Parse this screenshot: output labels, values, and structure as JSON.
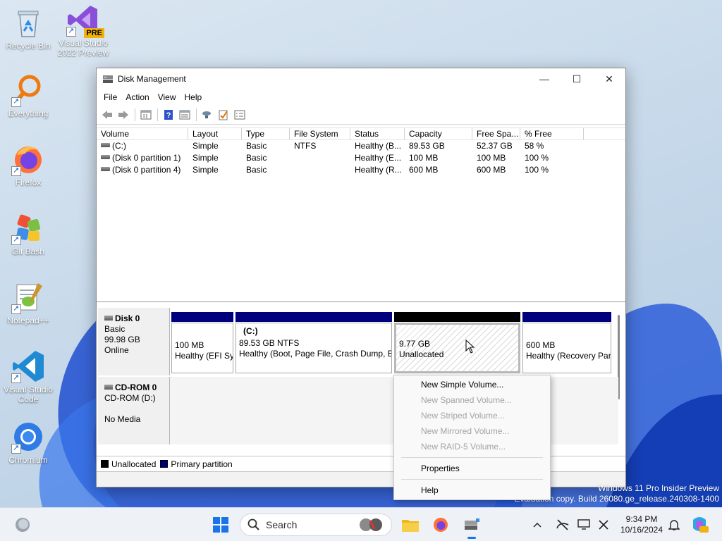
{
  "desktop": {
    "icons": [
      {
        "label": "Recycle Bin"
      },
      {
        "label": "Visual Studio\n2022 Preview",
        "badge": "PRE"
      },
      {
        "label": "Everything"
      },
      {
        "label": "Firefox"
      },
      {
        "label": "Git Bash"
      },
      {
        "label": "Notepad++"
      },
      {
        "label": "Visual Studio\nCode"
      },
      {
        "label": "Chromium"
      }
    ],
    "watermark": {
      "line1": "Windows 11 Pro Insider Preview",
      "line2": "Evaluation copy. Build 26080.ge_release.240308-1400"
    }
  },
  "window": {
    "title": "Disk Management",
    "icon": "disk-management-icon",
    "controls": {
      "minimize": "—",
      "maximize": "☐",
      "close": "✕"
    },
    "menu": [
      "File",
      "Action",
      "View",
      "Help"
    ],
    "toolbar": [
      "back-arrow-icon",
      "forward-arrow-icon",
      "console-tree-icon",
      "help-icon",
      "details-pane-icon",
      "connect-icon",
      "check-icon",
      "properties-list-icon"
    ]
  },
  "volume_list": {
    "columns": [
      "Volume",
      "Layout",
      "Type",
      "File System",
      "Status",
      "Capacity",
      "Free Spa...",
      "% Free"
    ],
    "rows": [
      [
        "(C:)",
        "Simple",
        "Basic",
        "NTFS",
        "Healthy (B...",
        "89.53 GB",
        "52.37 GB",
        "58 %"
      ],
      [
        "(Disk 0 partition 1)",
        "Simple",
        "Basic",
        "",
        "Healthy (E...",
        "100 MB",
        "100 MB",
        "100 %"
      ],
      [
        "(Disk 0 partition 4)",
        "Simple",
        "Basic",
        "",
        "Healthy (R...",
        "600 MB",
        "600 MB",
        "100 %"
      ]
    ]
  },
  "disk0": {
    "name": "Disk 0",
    "type": "Basic",
    "size": "99.98 GB",
    "status": "Online",
    "partitions": [
      {
        "line1": "100 MB",
        "line2": "Healthy (EFI System Partition)",
        "kind": "primary"
      },
      {
        "title": "(C:)",
        "line1": "89.53 GB NTFS",
        "line2": "Healthy (Boot, Page File, Crash Dump, Basic Data Partition)",
        "kind": "primary"
      },
      {
        "line1": "9.77 GB",
        "line2": "Unallocated",
        "kind": "unallocated"
      },
      {
        "line1": "600 MB",
        "line2": "Healthy (Recovery Partition)",
        "kind": "primary"
      }
    ]
  },
  "cdrom0": {
    "name": "CD-ROM 0",
    "drive": "CD-ROM (D:)",
    "status": "No Media"
  },
  "legend": {
    "unallocated": "Unallocated",
    "primary": "Primary partition",
    "unallocated_color": "#000000",
    "primary_color": "#00007f"
  },
  "context_menu": {
    "items": [
      {
        "label": "New Simple Volume...",
        "enabled": true
      },
      {
        "label": "New Spanned Volume...",
        "enabled": false
      },
      {
        "label": "New Striped Volume...",
        "enabled": false
      },
      {
        "label": "New Mirrored Volume...",
        "enabled": false
      },
      {
        "label": "New RAID-5 Volume...",
        "enabled": false
      },
      {
        "label": "Properties",
        "enabled": true
      },
      {
        "label": "Help",
        "enabled": true
      }
    ]
  },
  "taskbar": {
    "search_label": "Search",
    "time": "9:34 PM",
    "date": "10/16/2024",
    "apps": [
      "widgets-icon",
      "start-icon",
      "search-icon",
      "file-explorer-icon",
      "firefox-icon",
      "disk-management-icon"
    ],
    "tray": [
      "chevron-up-icon",
      "network-off-icon",
      "display-icon",
      "settings-icon",
      "notifications-bell-icon",
      "copilot-icon"
    ]
  }
}
